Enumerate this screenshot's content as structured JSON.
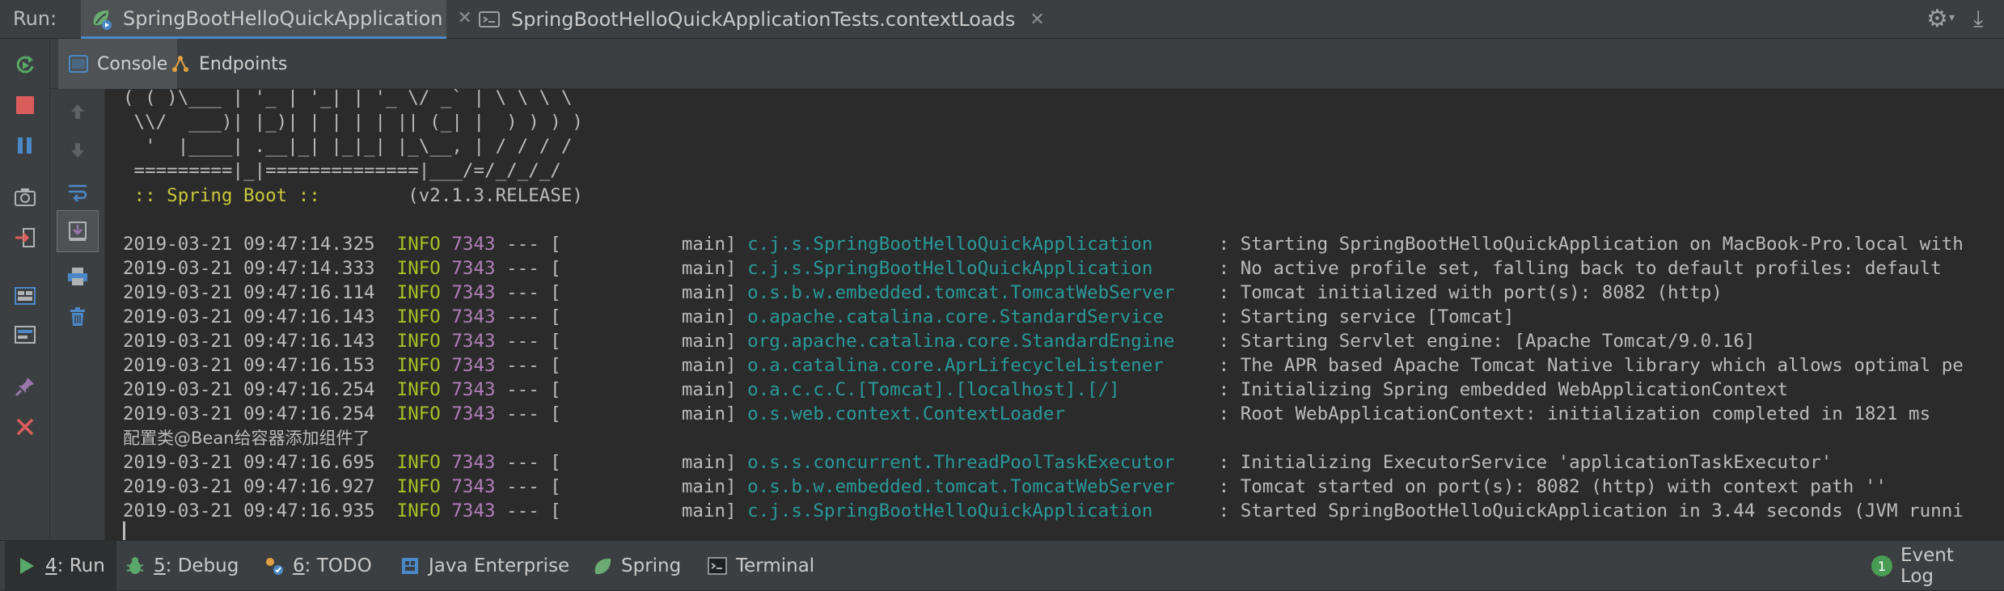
{
  "run_panel": {
    "label": "Run:",
    "tabs": [
      {
        "label": "SpringBootHelloQuickApplication",
        "active": true
      },
      {
        "label": "SpringBootHelloQuickApplicationTests.contextLoads",
        "active": false
      }
    ]
  },
  "subtabs": [
    {
      "label": "Console",
      "active": true
    },
    {
      "label": "Endpoints",
      "active": false
    }
  ],
  "console": {
    "banner": [
      "( ( )\\___ | '_ | '_| | '_ \\/ _` | \\ \\ \\ \\",
      " \\\\/  ___)| |_)| | | | | || (_| |  ) ) ) )",
      "  '  |____| .__|_| |_|_| |_\\__, | / / / /",
      " =========|_|==============|___/=/_/_/_/"
    ],
    "boot_label": " :: Spring Boot :: ",
    "boot_version": "       (v2.1.3.RELEASE)",
    "log_lines": [
      {
        "ts": "2019-03-21 09:47:14.325",
        "level": "INFO",
        "pid": "7343",
        "sep": "--- [",
        "thread": "           main]",
        "logger": "c.j.s.SpringBootHelloQuickApplication   ",
        "msg": "   : Starting SpringBootHelloQuickApplication on MacBook-Pro.local with"
      },
      {
        "ts": "2019-03-21 09:47:14.333",
        "level": "INFO",
        "pid": "7343",
        "sep": "--- [",
        "thread": "           main]",
        "logger": "c.j.s.SpringBootHelloQuickApplication   ",
        "msg": "   : No active profile set, falling back to default profiles: default"
      },
      {
        "ts": "2019-03-21 09:47:16.114",
        "level": "INFO",
        "pid": "7343",
        "sep": "--- [",
        "thread": "           main]",
        "logger": "o.s.b.w.embedded.tomcat.TomcatWebServer ",
        "msg": "   : Tomcat initialized with port(s): 8082 (http)"
      },
      {
        "ts": "2019-03-21 09:47:16.143",
        "level": "INFO",
        "pid": "7343",
        "sep": "--- [",
        "thread": "           main]",
        "logger": "o.apache.catalina.core.StandardService  ",
        "msg": "   : Starting service [Tomcat]"
      },
      {
        "ts": "2019-03-21 09:47:16.143",
        "level": "INFO",
        "pid": "7343",
        "sep": "--- [",
        "thread": "           main]",
        "logger": "org.apache.catalina.core.StandardEngine ",
        "msg": "   : Starting Servlet engine: [Apache Tomcat/9.0.16]"
      },
      {
        "ts": "2019-03-21 09:47:16.153",
        "level": "INFO",
        "pid": "7343",
        "sep": "--- [",
        "thread": "           main]",
        "logger": "o.a.catalina.core.AprLifecycleListener  ",
        "msg": "   : The APR based Apache Tomcat Native library which allows optimal pe"
      },
      {
        "ts": "2019-03-21 09:47:16.254",
        "level": "INFO",
        "pid": "7343",
        "sep": "--- [",
        "thread": "           main]",
        "logger": "o.a.c.c.C.[Tomcat].[localhost].[/]      ",
        "msg": "   : Initializing Spring embedded WebApplicationContext"
      },
      {
        "ts": "2019-03-21 09:47:16.254",
        "level": "INFO",
        "pid": "7343",
        "sep": "--- [",
        "thread": "           main]",
        "logger": "o.s.web.context.ContextLoader           ",
        "msg": "   : Root WebApplicationContext: initialization completed in 1821 ms"
      }
    ],
    "plain_line": "配置类@Bean给容器添加组件了",
    "log_lines_2": [
      {
        "ts": "2019-03-21 09:47:16.695",
        "level": "INFO",
        "pid": "7343",
        "sep": "--- [",
        "thread": "           main]",
        "logger": "o.s.s.concurrent.ThreadPoolTaskExecutor ",
        "msg": "   : Initializing ExecutorService 'applicationTaskExecutor'"
      },
      {
        "ts": "2019-03-21 09:47:16.927",
        "level": "INFO",
        "pid": "7343",
        "sep": "--- [",
        "thread": "           main]",
        "logger": "o.s.b.w.embedded.tomcat.TomcatWebServer ",
        "msg": "   : Tomcat started on port(s): 8082 (http) with context path ''"
      },
      {
        "ts": "2019-03-21 09:47:16.935",
        "level": "INFO",
        "pid": "7343",
        "sep": "--- [",
        "thread": "           main]",
        "logger": "c.j.s.SpringBootHelloQuickApplication   ",
        "msg": "   : Started SpringBootHelloQuickApplication in 3.44 seconds (JVM runni"
      }
    ]
  },
  "bottom_tabs": [
    {
      "num": "4",
      "label": ": Run",
      "active": true
    },
    {
      "num": "5",
      "label": ": Debug",
      "active": false
    },
    {
      "num": "6",
      "label": ": TODO",
      "active": false
    },
    {
      "num": "",
      "label": "Java Enterprise",
      "active": false
    },
    {
      "num": "",
      "label": "Spring",
      "active": false
    },
    {
      "num": "",
      "label": "Terminal",
      "active": false
    }
  ],
  "event_log": {
    "count": "1",
    "label": "Event Log"
  },
  "colors": {
    "info": "#a8c023",
    "pid": "#b07fb8",
    "logger": "#299999",
    "boot": "#c8c83c",
    "bg": "#2b2b2b",
    "chrome": "#3c3f41"
  }
}
